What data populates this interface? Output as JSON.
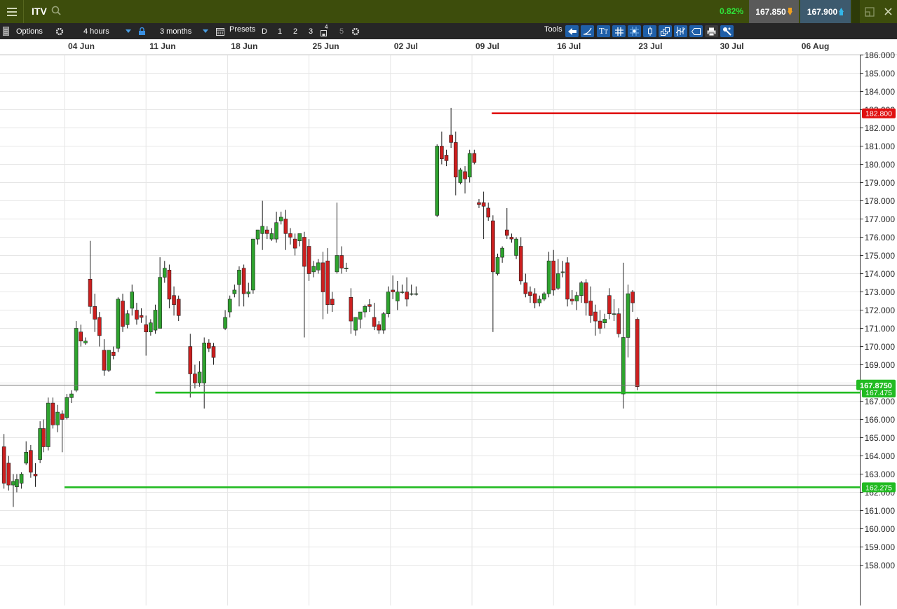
{
  "header": {
    "symbol": "ITV",
    "change_pct": "0.82%",
    "sell_price": "167.850",
    "buy_price": "167.900"
  },
  "toolbar": {
    "options_label": "Options",
    "interval_value": "4 hours",
    "range_value": "3 months",
    "presets_label": "Presets",
    "presets": [
      "D",
      "1",
      "2",
      "3",
      "4",
      "5"
    ],
    "tools_label": "Tools"
  },
  "colors": {
    "header_bg": "#3d4d0c",
    "toolbar_bg": "#262626",
    "up_candle": "#2ea32e",
    "down_candle": "#cc1f1f",
    "resistance_line": "#e01010",
    "support_line": "#22bb22",
    "tool_button": "#1f5fa8"
  },
  "icons": [
    "menu-icon",
    "search-icon",
    "arrow-down-icon",
    "arrow-up-icon",
    "restore-window-icon",
    "close-icon",
    "gear-icon",
    "lock-icon",
    "calendar-icon",
    "ruler-icon"
  ],
  "chart_data": {
    "type": "candlestick",
    "x_tick_labels": [
      "04 Jun",
      "11 Jun",
      "18 Jun",
      "25 Jun",
      "02 Jul",
      "09 Jul",
      "16 Jul",
      "23 Jul",
      "30 Jul",
      "06 Aug"
    ],
    "y_tick_labels": [
      "158.000",
      "159.000",
      "160.000",
      "161.000",
      "162.000",
      "163.000",
      "164.000",
      "165.000",
      "166.000",
      "167.000",
      "168.000",
      "169.000",
      "170.000",
      "171.000",
      "172.000",
      "173.000",
      "174.000",
      "175.000",
      "176.000",
      "177.000",
      "178.000",
      "179.000",
      "180.000",
      "181.000",
      "182.000",
      "183.000",
      "184.000",
      "185.000",
      "186.000"
    ],
    "ylim": [
      157.2,
      186.0
    ],
    "grid": true,
    "current_price_label": "167.8750",
    "horizontal_lines": [
      {
        "value": 182.8,
        "label": "182.800",
        "color": "#e01010",
        "from_day": 36.7
      },
      {
        "value": 167.475,
        "label": "167.475",
        "color": "#22bb22",
        "from_day": 7.8
      },
      {
        "value": 162.275,
        "label": "162.275",
        "color": "#22bb22",
        "from_day": 0
      }
    ],
    "current_price": 167.875,
    "x_axis_origin_label": "04 Jun",
    "x_units": "days since 04 Jun (approx; each candle ~4h period)",
    "candles": [
      {
        "t": -5.2,
        "o": 164.5,
        "h": 165.2,
        "c": 162.5,
        "l": 162.2
      },
      {
        "t": -4.8,
        "o": 163.6,
        "h": 164.0,
        "c": 162.4,
        "l": 162.1
      },
      {
        "t": -4.4,
        "o": 162.4,
        "h": 163.0,
        "c": 162.6,
        "l": 161.2
      },
      {
        "t": -4.1,
        "o": 162.3,
        "h": 163.0,
        "c": 162.7,
        "l": 162.0
      },
      {
        "t": -3.7,
        "o": 162.5,
        "h": 163.1,
        "c": 163.0,
        "l": 162.2
      },
      {
        "t": -3.3,
        "o": 163.6,
        "h": 164.8,
        "c": 164.2,
        "l": 163.5
      },
      {
        "t": -2.9,
        "o": 164.3,
        "h": 164.6,
        "c": 163.1,
        "l": 162.8
      },
      {
        "t": -2.5,
        "o": 163.0,
        "h": 163.6,
        "c": 162.9,
        "l": 162.3
      },
      {
        "t": -2.1,
        "o": 163.8,
        "h": 165.9,
        "c": 165.5,
        "l": 163.6
      },
      {
        "t": -1.8,
        "o": 165.5,
        "h": 166.0,
        "c": 164.5,
        "l": 164.2
      },
      {
        "t": -1.4,
        "o": 164.5,
        "h": 167.2,
        "c": 166.9,
        "l": 164.3
      },
      {
        "t": -1.0,
        "o": 166.9,
        "h": 167.2,
        "c": 165.7,
        "l": 165.5
      },
      {
        "t": -0.6,
        "o": 165.7,
        "h": 166.8,
        "c": 166.4,
        "l": 165.3
      },
      {
        "t": -0.2,
        "o": 166.3,
        "h": 166.5,
        "c": 166.0,
        "l": 164.2
      },
      {
        "t": 0.2,
        "o": 166.1,
        "h": 167.4,
        "c": 167.2,
        "l": 166.0
      },
      {
        "t": 0.6,
        "o": 167.2,
        "h": 167.6,
        "c": 167.4,
        "l": 166.9
      },
      {
        "t": 1.0,
        "o": 167.6,
        "h": 171.4,
        "c": 171.0,
        "l": 167.5
      },
      {
        "t": 1.4,
        "o": 170.8,
        "h": 171.2,
        "c": 170.3,
        "l": 170.0
      },
      {
        "t": 1.8,
        "o": 170.2,
        "h": 170.5,
        "c": 170.3,
        "l": 170.1
      },
      {
        "t": 2.2,
        "o": 173.7,
        "h": 175.8,
        "c": 172.2,
        "l": 171.8
      },
      {
        "t": 2.6,
        "o": 172.2,
        "h": 172.9,
        "c": 171.5,
        "l": 170.8
      },
      {
        "t": 3.0,
        "o": 171.6,
        "h": 171.9,
        "c": 170.6,
        "l": 170.0
      },
      {
        "t": 3.4,
        "o": 169.8,
        "h": 170.4,
        "c": 168.7,
        "l": 168.4
      },
      {
        "t": 3.8,
        "o": 168.7,
        "h": 169.8,
        "c": 169.8,
        "l": 168.6
      },
      {
        "t": 4.2,
        "o": 169.7,
        "h": 170.0,
        "c": 169.5,
        "l": 169.3
      },
      {
        "t": 4.6,
        "o": 169.9,
        "h": 172.7,
        "c": 172.6,
        "l": 169.7
      },
      {
        "t": 5.0,
        "o": 172.5,
        "h": 172.9,
        "c": 171.1,
        "l": 170.8
      },
      {
        "t": 5.4,
        "o": 171.2,
        "h": 172.0,
        "c": 171.8,
        "l": 171.0
      },
      {
        "t": 5.8,
        "o": 172.1,
        "h": 173.4,
        "c": 173.0,
        "l": 171.7
      },
      {
        "t": 6.2,
        "o": 172.0,
        "h": 172.4,
        "c": 171.5,
        "l": 171.2
      },
      {
        "t": 6.6,
        "o": 171.7,
        "h": 172.1,
        "c": 171.6,
        "l": 171.3
      },
      {
        "t": 7.0,
        "o": 171.2,
        "h": 171.7,
        "c": 170.8,
        "l": 169.5
      },
      {
        "t": 7.4,
        "o": 170.8,
        "h": 171.5,
        "c": 171.3,
        "l": 170.6
      },
      {
        "t": 7.8,
        "o": 170.9,
        "h": 172.3,
        "c": 172.0,
        "l": 170.7
      },
      {
        "t": 8.2,
        "o": 171.0,
        "h": 174.9,
        "c": 173.8,
        "l": 171.0
      },
      {
        "t": 8.6,
        "o": 173.8,
        "h": 174.7,
        "c": 174.3,
        "l": 173.5
      },
      {
        "t": 9.0,
        "o": 174.2,
        "h": 174.5,
        "c": 172.6,
        "l": 172.1
      },
      {
        "t": 9.4,
        "o": 172.8,
        "h": 173.3,
        "c": 172.3,
        "l": 171.7
      },
      {
        "t": 9.8,
        "o": 172.6,
        "h": 172.8,
        "c": 171.7,
        "l": 171.4
      },
      {
        "t": 10.8,
        "o": 170.0,
        "h": 170.7,
        "c": 168.5,
        "l": 167.2
      },
      {
        "t": 11.2,
        "o": 168.5,
        "h": 169.0,
        "c": 168.0,
        "l": 167.7
      },
      {
        "t": 11.6,
        "o": 168.0,
        "h": 169.2,
        "c": 168.6,
        "l": 167.8
      },
      {
        "t": 12.0,
        "o": 168.0,
        "h": 170.5,
        "c": 170.2,
        "l": 166.6
      },
      {
        "t": 12.4,
        "o": 170.2,
        "h": 170.4,
        "c": 169.9,
        "l": 169.7
      },
      {
        "t": 12.8,
        "o": 170.0,
        "h": 170.2,
        "c": 169.4,
        "l": 169.0
      },
      {
        "t": 13.8,
        "o": 171.0,
        "h": 172.0,
        "c": 171.6,
        "l": 170.9
      },
      {
        "t": 14.2,
        "o": 171.9,
        "h": 172.8,
        "c": 172.6,
        "l": 171.6
      },
      {
        "t": 14.6,
        "o": 172.9,
        "h": 173.4,
        "c": 173.1,
        "l": 172.7
      },
      {
        "t": 15.0,
        "o": 173.4,
        "h": 174.4,
        "c": 174.2,
        "l": 172.2
      },
      {
        "t": 15.4,
        "o": 174.3,
        "h": 174.5,
        "c": 172.9,
        "l": 172.2
      },
      {
        "t": 15.8,
        "o": 172.9,
        "h": 173.5,
        "c": 173.0,
        "l": 172.7
      },
      {
        "t": 16.2,
        "o": 173.1,
        "h": 175.9,
        "c": 175.9,
        "l": 172.9
      },
      {
        "t": 16.6,
        "o": 175.9,
        "h": 176.4,
        "c": 176.4,
        "l": 175.6
      },
      {
        "t": 17.0,
        "o": 176.2,
        "h": 178.0,
        "c": 176.6,
        "l": 175.3
      },
      {
        "t": 17.4,
        "o": 176.4,
        "h": 176.6,
        "c": 176.2,
        "l": 175.9
      },
      {
        "t": 17.8,
        "o": 175.9,
        "h": 176.5,
        "c": 176.2,
        "l": 175.8
      },
      {
        "t": 18.2,
        "o": 175.9,
        "h": 177.4,
        "c": 176.8,
        "l": 175.7
      },
      {
        "t": 18.6,
        "o": 176.9,
        "h": 177.4,
        "c": 177.1,
        "l": 176.7
      },
      {
        "t": 19.0,
        "o": 177.0,
        "h": 177.5,
        "c": 176.2,
        "l": 175.3
      },
      {
        "t": 19.4,
        "o": 176.2,
        "h": 176.5,
        "c": 176.0,
        "l": 175.6
      },
      {
        "t": 19.8,
        "o": 175.9,
        "h": 176.2,
        "c": 175.4,
        "l": 175.0
      },
      {
        "t": 20.2,
        "o": 175.8,
        "h": 176.2,
        "c": 176.2,
        "l": 175.5
      },
      {
        "t": 20.6,
        "o": 176.0,
        "h": 176.3,
        "c": 174.4,
        "l": 170.5
      },
      {
        "t": 21.0,
        "o": 175.5,
        "h": 175.9,
        "c": 174.0,
        "l": 173.6
      },
      {
        "t": 21.4,
        "o": 174.1,
        "h": 174.7,
        "c": 174.4,
        "l": 173.8
      },
      {
        "t": 21.8,
        "o": 174.2,
        "h": 174.8,
        "c": 174.6,
        "l": 174.0
      },
      {
        "t": 22.2,
        "o": 174.6,
        "h": 175.2,
        "c": 173.0,
        "l": 171.5
      },
      {
        "t": 22.6,
        "o": 174.7,
        "h": 175.4,
        "c": 172.3,
        "l": 171.8
      },
      {
        "t": 23.0,
        "o": 172.6,
        "h": 173.0,
        "c": 172.3,
        "l": 171.9
      },
      {
        "t": 23.4,
        "o": 174.1,
        "h": 177.9,
        "c": 175.0,
        "l": 174.0
      },
      {
        "t": 23.8,
        "o": 175.0,
        "h": 175.5,
        "c": 174.3,
        "l": 174.0
      },
      {
        "t": 24.2,
        "o": 174.3,
        "h": 174.6,
        "c": 174.3,
        "l": 174.1
      },
      {
        "t": 24.6,
        "o": 172.7,
        "h": 173.2,
        "c": 171.4,
        "l": 170.7
      },
      {
        "t": 25.0,
        "o": 170.9,
        "h": 171.4,
        "c": 171.6,
        "l": 170.6
      },
      {
        "t": 25.4,
        "o": 171.5,
        "h": 171.9,
        "c": 171.9,
        "l": 171.0
      },
      {
        "t": 25.8,
        "o": 171.9,
        "h": 172.3,
        "c": 172.2,
        "l": 171.6
      },
      {
        "t": 26.2,
        "o": 172.3,
        "h": 172.6,
        "c": 172.2,
        "l": 171.9
      },
      {
        "t": 26.6,
        "o": 171.6,
        "h": 172.4,
        "c": 171.1,
        "l": 170.9
      },
      {
        "t": 27.0,
        "o": 171.2,
        "h": 171.4,
        "c": 170.9,
        "l": 170.7
      },
      {
        "t": 27.4,
        "o": 170.9,
        "h": 171.9,
        "c": 171.8,
        "l": 170.7
      },
      {
        "t": 27.8,
        "o": 171.8,
        "h": 173.3,
        "c": 173.0,
        "l": 171.6
      },
      {
        "t": 28.2,
        "o": 173.1,
        "h": 173.9,
        "c": 173.0,
        "l": 172.6
      },
      {
        "t": 28.6,
        "o": 172.5,
        "h": 173.6,
        "c": 173.0,
        "l": 172.0
      },
      {
        "t": 29.0,
        "o": 173.0,
        "h": 173.4,
        "c": 173.0,
        "l": 172.9
      },
      {
        "t": 29.4,
        "o": 173.0,
        "h": 173.8,
        "c": 172.6,
        "l": 172.2
      },
      {
        "t": 29.8,
        "o": 172.9,
        "h": 173.4,
        "c": 172.9,
        "l": 172.8
      },
      {
        "t": 30.2,
        "o": 172.9,
        "h": 173.3,
        "c": 172.9,
        "l": 172.8
      },
      {
        "t": 32.0,
        "o": 177.2,
        "h": 181.1,
        "c": 181.0,
        "l": 177.1
      },
      {
        "t": 32.4,
        "o": 181.0,
        "h": 181.8,
        "c": 180.3,
        "l": 180.0
      },
      {
        "t": 32.8,
        "o": 180.5,
        "h": 180.8,
        "c": 180.2,
        "l": 179.9
      },
      {
        "t": 33.2,
        "o": 181.6,
        "h": 183.1,
        "c": 181.2,
        "l": 180.9
      },
      {
        "t": 33.6,
        "o": 181.2,
        "h": 181.8,
        "c": 179.3,
        "l": 178.3
      },
      {
        "t": 34.0,
        "o": 179.0,
        "h": 179.8,
        "c": 179.7,
        "l": 178.9
      },
      {
        "t": 34.4,
        "o": 179.6,
        "h": 179.9,
        "c": 179.2,
        "l": 178.4
      },
      {
        "t": 34.8,
        "o": 179.3,
        "h": 180.8,
        "c": 180.6,
        "l": 179.0
      },
      {
        "t": 35.2,
        "o": 180.6,
        "h": 180.8,
        "c": 180.1,
        "l": 180.0
      },
      {
        "t": 35.6,
        "o": 177.9,
        "h": 178.1,
        "c": 177.8,
        "l": 177.6
      },
      {
        "t": 36.0,
        "o": 177.9,
        "h": 178.5,
        "c": 177.7,
        "l": 175.9
      },
      {
        "t": 36.4,
        "o": 177.6,
        "h": 177.9,
        "c": 177.1,
        "l": 176.9
      },
      {
        "t": 36.8,
        "o": 176.9,
        "h": 177.2,
        "c": 174.1,
        "l": 170.8
      },
      {
        "t": 37.2,
        "o": 174.0,
        "h": 175.1,
        "c": 174.9,
        "l": 173.9
      },
      {
        "t": 37.6,
        "o": 174.9,
        "h": 175.5,
        "c": 175.4,
        "l": 174.6
      },
      {
        "t": 38.0,
        "o": 176.4,
        "h": 177.6,
        "c": 176.1,
        "l": 175.9
      },
      {
        "t": 38.4,
        "o": 176.0,
        "h": 176.2,
        "c": 175.9,
        "l": 175.7
      },
      {
        "t": 38.8,
        "o": 175.0,
        "h": 176.0,
        "c": 175.9,
        "l": 174.8
      },
      {
        "t": 39.2,
        "o": 175.5,
        "h": 176.0,
        "c": 173.6,
        "l": 173.4
      },
      {
        "t": 39.6,
        "o": 173.5,
        "h": 174.0,
        "c": 172.9,
        "l": 172.7
      },
      {
        "t": 40.0,
        "o": 173.0,
        "h": 173.3,
        "c": 172.8,
        "l": 172.4
      },
      {
        "t": 40.4,
        "o": 172.9,
        "h": 173.2,
        "c": 172.4,
        "l": 172.1
      },
      {
        "t": 40.8,
        "o": 172.4,
        "h": 172.8,
        "c": 172.6,
        "l": 172.2
      },
      {
        "t": 41.2,
        "o": 172.6,
        "h": 173.0,
        "c": 172.9,
        "l": 172.5
      },
      {
        "t": 41.6,
        "o": 172.9,
        "h": 175.2,
        "c": 174.7,
        "l": 172.7
      },
      {
        "t": 42.0,
        "o": 174.7,
        "h": 175.3,
        "c": 173.1,
        "l": 172.8
      },
      {
        "t": 42.4,
        "o": 173.2,
        "h": 174.8,
        "c": 174.0,
        "l": 173.1
      },
      {
        "t": 42.8,
        "o": 174.1,
        "h": 174.7,
        "c": 174.1,
        "l": 173.8
      },
      {
        "t": 43.2,
        "o": 174.6,
        "h": 174.9,
        "c": 172.6,
        "l": 172.2
      },
      {
        "t": 43.6,
        "o": 172.6,
        "h": 173.1,
        "c": 172.5,
        "l": 172.3
      },
      {
        "t": 44.0,
        "o": 172.5,
        "h": 173.0,
        "c": 172.8,
        "l": 172.0
      },
      {
        "t": 44.4,
        "o": 172.8,
        "h": 173.6,
        "c": 173.5,
        "l": 172.4
      },
      {
        "t": 44.8,
        "o": 173.5,
        "h": 173.7,
        "c": 172.4,
        "l": 171.7
      },
      {
        "t": 45.2,
        "o": 172.5,
        "h": 173.3,
        "c": 171.7,
        "l": 171.3
      },
      {
        "t": 45.6,
        "o": 171.9,
        "h": 172.3,
        "c": 171.4,
        "l": 170.6
      },
      {
        "t": 46.0,
        "o": 171.4,
        "h": 172.0,
        "c": 171.0,
        "l": 170.7
      },
      {
        "t": 46.4,
        "o": 171.3,
        "h": 171.8,
        "c": 171.5,
        "l": 171.0
      },
      {
        "t": 46.8,
        "o": 172.8,
        "h": 173.2,
        "c": 171.8,
        "l": 171.5
      },
      {
        "t": 47.2,
        "o": 171.8,
        "h": 172.6,
        "c": 171.8,
        "l": 171.4
      },
      {
        "t": 47.6,
        "o": 171.8,
        "h": 172.1,
        "c": 170.7,
        "l": 170.5
      },
      {
        "t": 48.0,
        "o": 167.4,
        "h": 174.6,
        "c": 170.5,
        "l": 166.6
      },
      {
        "t": 48.4,
        "o": 170.5,
        "h": 173.4,
        "c": 172.9,
        "l": 169.4
      },
      {
        "t": 48.8,
        "o": 173.0,
        "h": 173.1,
        "c": 172.4,
        "l": 171.9
      },
      {
        "t": 49.2,
        "o": 171.5,
        "h": 171.6,
        "c": 167.8,
        "l": 167.6
      }
    ]
  }
}
